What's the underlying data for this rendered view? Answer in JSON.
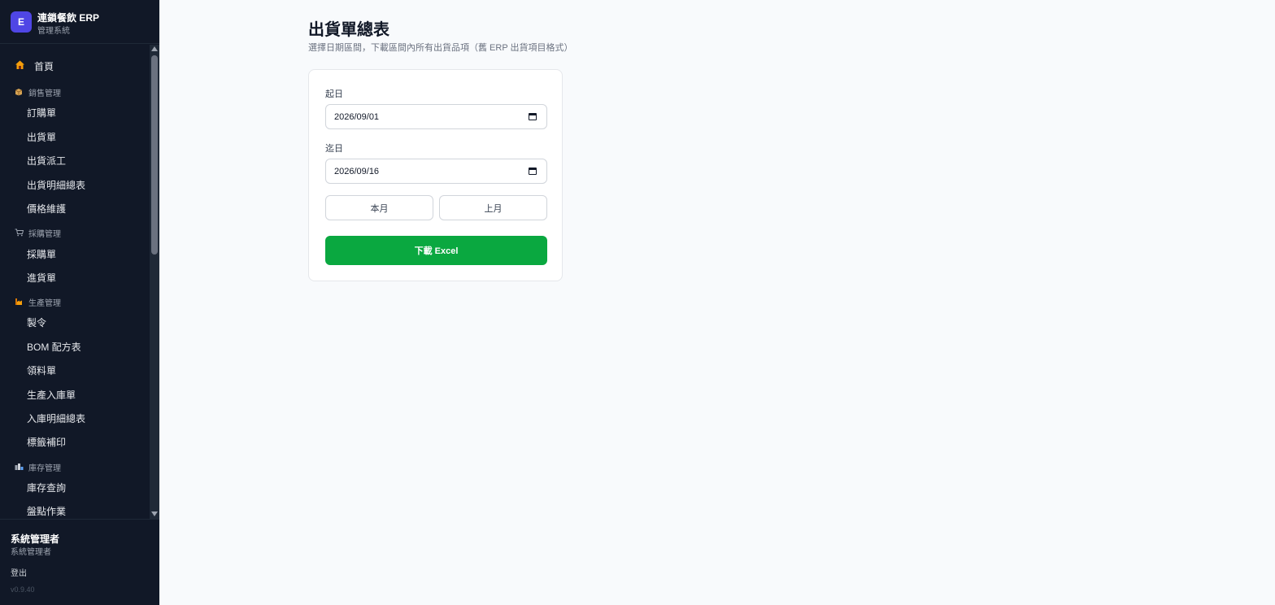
{
  "brand": {
    "logo_letter": "E",
    "name": "連鎖餐飲 ERP",
    "subtitle": "管理系統"
  },
  "sidebar": {
    "home": {
      "icon": "house-icon",
      "label": "首頁"
    },
    "groups": [
      {
        "icon": "box-icon",
        "label": "銷售管理",
        "items": [
          {
            "label": "訂購單"
          },
          {
            "label": "出貨單"
          },
          {
            "label": "出貨派工"
          },
          {
            "label": "出貨明細總表"
          },
          {
            "label": "價格維護"
          }
        ]
      },
      {
        "icon": "cart-icon",
        "label": "採購管理",
        "items": [
          {
            "label": "採購單"
          },
          {
            "label": "進貨單"
          }
        ]
      },
      {
        "icon": "factory-icon",
        "label": "生產管理",
        "items": [
          {
            "label": "製令"
          },
          {
            "label": "BOM 配方表"
          },
          {
            "label": "領料單"
          },
          {
            "label": "生產入庫單"
          },
          {
            "label": "入庫明細總表"
          },
          {
            "label": "標籤補印"
          }
        ]
      },
      {
        "icon": "warehouse-icon",
        "label": "庫存管理",
        "items": [
          {
            "label": "庫存查詢"
          },
          {
            "label": "盤點作業"
          }
        ]
      }
    ]
  },
  "footer": {
    "user_name": "系統管理者",
    "user_role": "系統管理者",
    "logout": "登出",
    "version": "v0.9.40"
  },
  "main": {
    "title": "出貨單總表",
    "subtitle": "選擇日期區間，下載區間內所有出貨品項（舊 ERP 出貨項目格式）",
    "start_label": "起日",
    "start_value": "2026/09/01",
    "end_label": "迄日",
    "end_value": "2026/09/16",
    "this_month": "本月",
    "last_month": "上月",
    "download": "下載 Excel"
  },
  "colors": {
    "sidebar_bg": "#111827",
    "accent": "#4f46e5",
    "download_green": "#0aa840"
  }
}
